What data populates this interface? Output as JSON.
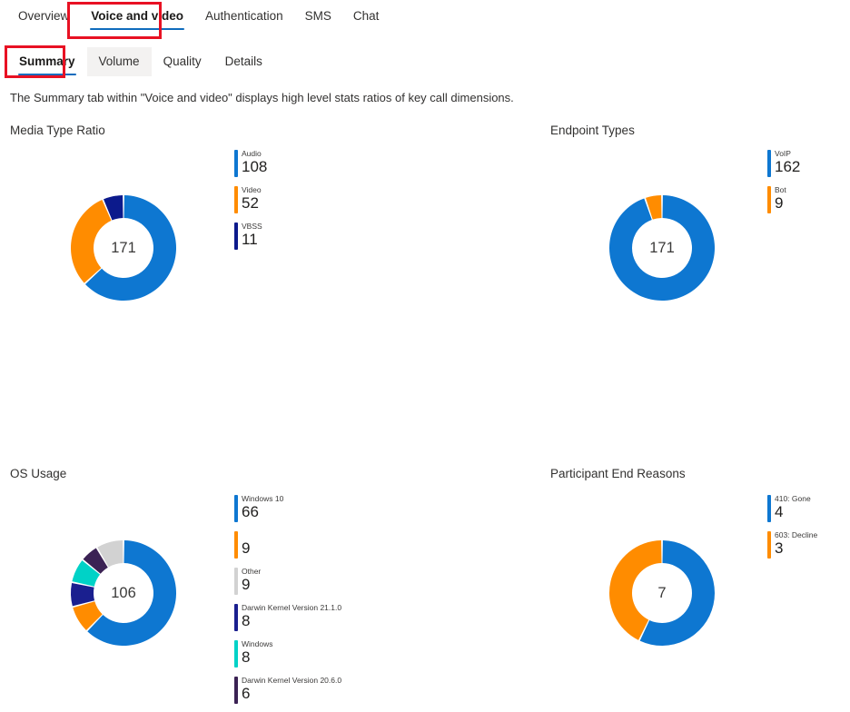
{
  "primary_tabs": [
    {
      "label": "Overview",
      "selected": false
    },
    {
      "label": "Voice and video",
      "selected": true
    },
    {
      "label": "Authentication",
      "selected": false
    },
    {
      "label": "SMS",
      "selected": false
    },
    {
      "label": "Chat",
      "selected": false
    }
  ],
  "secondary_tabs": [
    {
      "label": "Summary",
      "selected": true,
      "hovered": false
    },
    {
      "label": "Volume",
      "selected": false,
      "hovered": true
    },
    {
      "label": "Quality",
      "selected": false,
      "hovered": false
    },
    {
      "label": "Details",
      "selected": false,
      "hovered": false
    }
  ],
  "description": "The Summary tab within \"Voice and video\" displays high level stats ratios of key call dimensions.",
  "colors": {
    "accent_blue": "#0f6cbd",
    "annotation_red": "#e81123",
    "series_blue": "#0e77d1",
    "series_orange": "#ff8c00",
    "series_navy": "#0c1a8c",
    "series_gray": "#d2d2d2",
    "series_indigo": "#1a1f8f",
    "series_teal": "#00d2c7",
    "series_purple": "#3b2254",
    "hover_bg": "#f3f2f1"
  },
  "chart_data": [
    {
      "type": "pie",
      "id": "media-type-ratio",
      "title": "Media Type Ratio",
      "center_total": "171",
      "legend_position": "right",
      "categories": [
        "Audio",
        "Video",
        "VBSS"
      ],
      "values": [
        108,
        52,
        11
      ],
      "colors": [
        "#0e77d1",
        "#ff8c00",
        "#0c1a8c"
      ]
    },
    {
      "type": "pie",
      "id": "endpoint-types",
      "title": "Endpoint Types",
      "center_total": "171",
      "legend_position": "right",
      "categories": [
        "VoIP",
        "Bot"
      ],
      "values": [
        162,
        9
      ],
      "colors": [
        "#0e77d1",
        "#ff8c00"
      ]
    },
    {
      "type": "pie",
      "id": "os-usage",
      "title": "OS Usage",
      "center_total": "106",
      "legend_position": "right",
      "categories": [
        "Windows 10",
        "",
        "Other",
        "Darwin Kernel Version 21.1.0",
        "Windows",
        "Darwin Kernel Version 20.6.0"
      ],
      "values": [
        66,
        9,
        9,
        8,
        8,
        6
      ],
      "colors": [
        "#0e77d1",
        "#ff8c00",
        "#d2d2d2",
        "#1a1f8f",
        "#00d2c7",
        "#3b2254"
      ],
      "slice_order": [
        "Windows 10",
        "",
        "Darwin Kernel Version 21.1.0",
        "Windows",
        "Darwin Kernel Version 20.6.0",
        "Other"
      ]
    },
    {
      "type": "pie",
      "id": "participant-end-reasons",
      "title": "Participant End Reasons",
      "center_total": "7",
      "legend_position": "right",
      "categories": [
        "410: Gone",
        "603: Decline"
      ],
      "values": [
        4,
        3
      ],
      "colors": [
        "#0e77d1",
        "#ff8c00"
      ]
    }
  ]
}
